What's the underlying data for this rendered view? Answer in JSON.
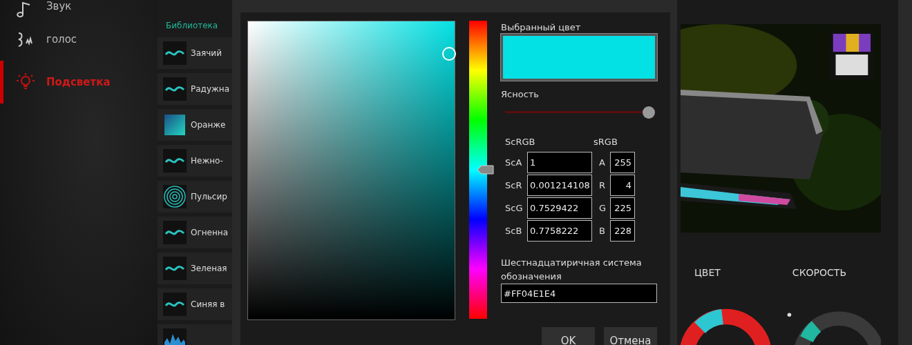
{
  "sidebar": {
    "items": [
      {
        "label": "Звук",
        "selected": false
      },
      {
        "label": "голос",
        "selected": false
      },
      {
        "label": "Подсветка",
        "selected": true
      }
    ]
  },
  "presets": {
    "section": "Библиотека",
    "items": [
      {
        "label": "Заячий",
        "kind": "wave"
      },
      {
        "label": "Радужна",
        "kind": "wave"
      },
      {
        "label": "Оранже",
        "kind": "gradient"
      },
      {
        "label": "Нежно-",
        "kind": "wave"
      },
      {
        "label": "Пульсир",
        "kind": "pulse"
      },
      {
        "label": "Огненна",
        "kind": "wave"
      },
      {
        "label": "Зеленая",
        "kind": "wave"
      },
      {
        "label": "Синяя в",
        "kind": "wave"
      },
      {
        "kind": "spectrum"
      }
    ]
  },
  "color_dialog": {
    "selected_label": "Выбранный цвет",
    "hue": {
      "level": 0.5
    },
    "brightness": {
      "label": "Ясность",
      "level": 0.97
    },
    "scrgb": {
      "heading": "ScRGB",
      "fields": [
        {
          "label": "ScA",
          "value": "1"
        },
        {
          "label": "ScR",
          "value": "0.001214108"
        },
        {
          "label": "ScG",
          "value": "0.7529422"
        },
        {
          "label": "ScB",
          "value": "0.7758222"
        }
      ]
    },
    "srgb": {
      "heading": "sRGB",
      "fields": [
        {
          "label": "A",
          "value": "255"
        },
        {
          "label": "R",
          "value": "4"
        },
        {
          "label": "G",
          "value": "225"
        },
        {
          "label": "B",
          "value": "228"
        }
      ]
    },
    "hex": {
      "label": "Шестнадцатиричная система обозначения",
      "value": "#FF04E1E4"
    },
    "buttons": [
      "OK",
      "Отмена"
    ]
  },
  "effect_panel": {
    "labels": [
      "ЦВЕТ",
      "СКОРОСТЬ"
    ]
  }
}
